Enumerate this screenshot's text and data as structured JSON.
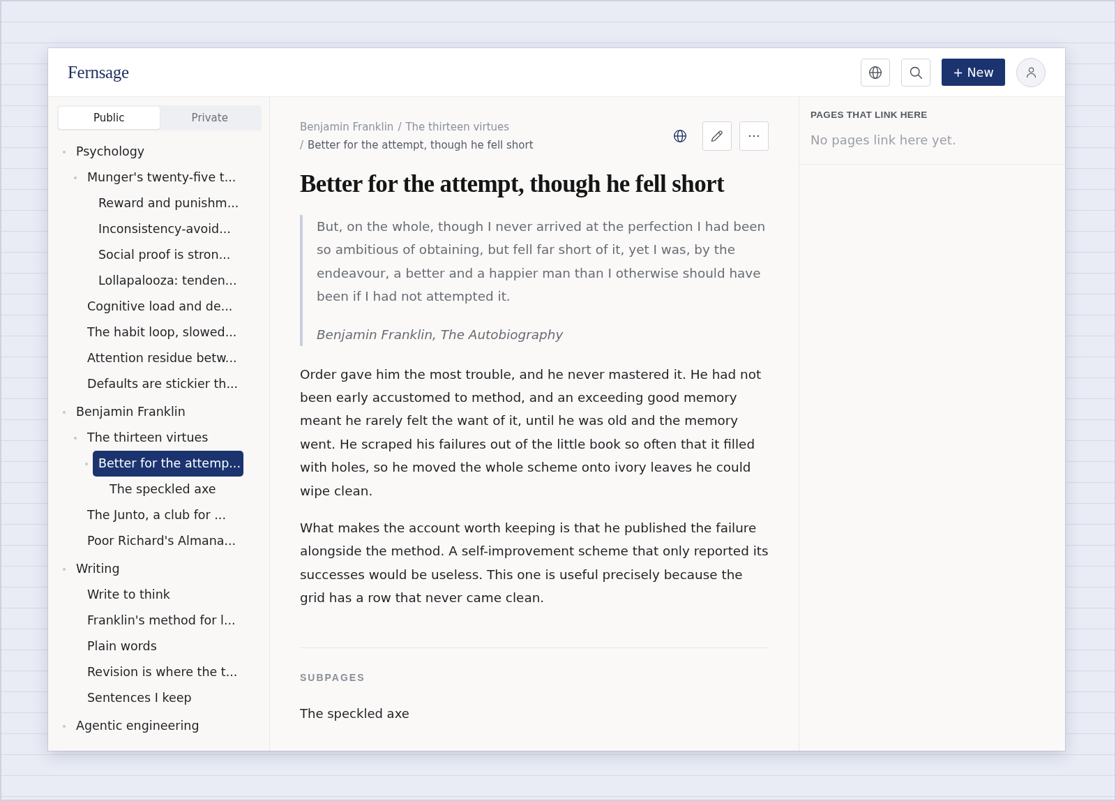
{
  "app": {
    "logo": "Fernsage",
    "new_button": "+ New"
  },
  "sidebar": {
    "tabs": [
      {
        "label": "Public",
        "selected": true
      },
      {
        "label": "Private",
        "selected": false
      }
    ],
    "tree": [
      {
        "label": "Psychology",
        "expanded": true,
        "selected": false,
        "children": [
          {
            "label": "Munger's twenty-five t...",
            "expanded": true,
            "selected": false,
            "children": [
              {
                "label": "Reward and punishm...",
                "expanded": false,
                "selected": false
              },
              {
                "label": "Inconsistency-avoid...",
                "expanded": false,
                "selected": false
              },
              {
                "label": "Social proof is stron...",
                "expanded": false,
                "selected": false
              },
              {
                "label": "Lollapalooza: tenden...",
                "expanded": false,
                "selected": false
              }
            ]
          },
          {
            "label": "Cognitive load and de...",
            "expanded": false,
            "selected": false
          },
          {
            "label": "The habit loop, slowed...",
            "expanded": false,
            "selected": false
          },
          {
            "label": "Attention residue betw...",
            "expanded": false,
            "selected": false
          },
          {
            "label": "Defaults are stickier th...",
            "expanded": false,
            "selected": false
          }
        ]
      },
      {
        "label": "Benjamin Franklin",
        "expanded": true,
        "selected": false,
        "children": [
          {
            "label": "The thirteen virtues",
            "expanded": true,
            "selected": false,
            "children": [
              {
                "label": "Better for the attemp...",
                "expanded": true,
                "selected": true,
                "children": [
                  {
                    "label": "The speckled axe",
                    "expanded": false,
                    "selected": false
                  }
                ]
              }
            ]
          },
          {
            "label": "The Junto, a club for ...",
            "expanded": false,
            "selected": false
          },
          {
            "label": "Poor Richard's Almana...",
            "expanded": false,
            "selected": false
          }
        ]
      },
      {
        "label": "Writing",
        "expanded": true,
        "selected": false,
        "children": [
          {
            "label": "Write to think",
            "expanded": false,
            "selected": false
          },
          {
            "label": "Franklin's method for l...",
            "expanded": false,
            "selected": false
          },
          {
            "label": "Plain words",
            "expanded": false,
            "selected": false
          },
          {
            "label": "Revision is where the t...",
            "expanded": false,
            "selected": false
          },
          {
            "label": "Sentences I keep",
            "expanded": false,
            "selected": false
          }
        ]
      },
      {
        "label": "Agentic engineering",
        "expanded": true,
        "selected": false
      }
    ]
  },
  "page": {
    "breadcrumb": [
      {
        "label": "Benjamin Franklin",
        "current": false
      },
      {
        "separator": "/",
        "label": "The thirteen virtues",
        "current": false
      },
      {
        "separator": "/",
        "label": "Better for the attempt, though he fell short",
        "current": true
      }
    ],
    "title": "Better for the attempt, though he fell short",
    "quote": {
      "text": "But, on the whole, though I never arrived at the perfection I had been so ambitious of obtaining, but fell far short of it, yet I was, by the endeavour, a better and a happier man than I otherwise should have been if I had not attempted it.",
      "citation": "Benjamin Franklin, The Autobiography"
    },
    "paragraphs": [
      "Order gave him the most trouble, and he never mastered it. He had not been early accustomed to method, and an exceeding good memory meant he rarely felt the want of it, until he was old and the memory went. He scraped his failures out of the little book so often that it filled with holes, so he moved the whole scheme onto ivory leaves he could wipe clean.",
      "What makes the account worth keeping is that he published the failure alongside the method. A self-improvement scheme that only reported its successes would be useless. This one is useful precisely because the grid has a row that never came clean."
    ],
    "subpages": {
      "heading": "SUBPAGES",
      "items": [
        "The speckled axe"
      ]
    }
  },
  "backlinks": {
    "heading": "PAGES THAT LINK HERE",
    "empty_text": "No pages link here yet."
  }
}
